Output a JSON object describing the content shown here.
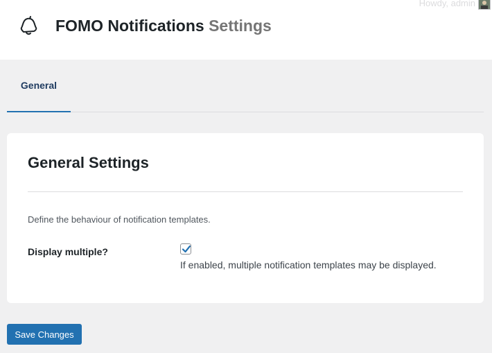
{
  "admin_bar": {
    "greeting": "Howdy, admin"
  },
  "header": {
    "title_main": "FOMO Notifications",
    "title_sub": "Settings"
  },
  "tabs": [
    {
      "label": "General",
      "active": true
    }
  ],
  "section": {
    "title": "General Settings",
    "description": "Define the behaviour of notification templates.",
    "fields": [
      {
        "label": "Display multiple?",
        "checked": true,
        "help": "If enabled, multiple notification templates may be displayed."
      }
    ]
  },
  "actions": {
    "save_label": "Save Changes"
  },
  "colors": {
    "accent": "#2271b1",
    "background": "#f0f0f1",
    "card": "#ffffff"
  },
  "icons": {
    "logo": "bell-icon",
    "checkbox_mark": "check-icon"
  }
}
